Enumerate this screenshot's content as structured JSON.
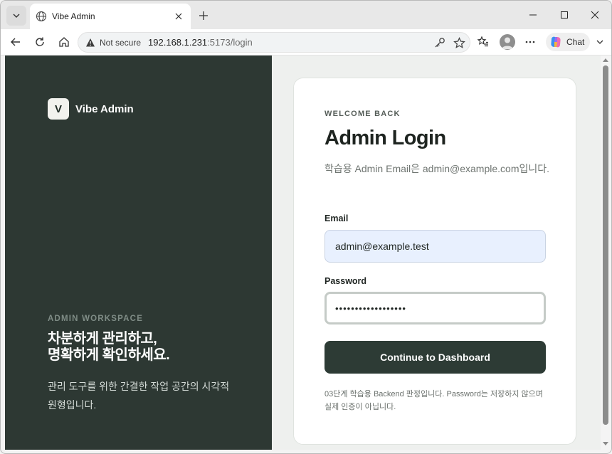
{
  "browser": {
    "tab": {
      "title": "Vibe Admin",
      "icon": "globe-icon"
    },
    "address": {
      "security_label": "Not secure",
      "url_host": "192.168.1.231",
      "url_rest": ":5173/login"
    },
    "chat_label": "Chat"
  },
  "left_panel": {
    "brand_mark": "V",
    "brand_name": "Vibe Admin",
    "eyebrow": "ADMIN WORKSPACE",
    "headline_line1": "차분하게 관리하고,",
    "headline_line2": "명확하게 확인하세요.",
    "description": "관리 도구를 위한 간결한 작업 공간의 시각적 원형입니다."
  },
  "login": {
    "eyebrow": "WELCOME BACK",
    "title": "Admin Login",
    "subtitle": "학습용 Admin Email은 admin@example.com입니다.",
    "email_label": "Email",
    "email_value": "admin@example.test",
    "password_label": "Password",
    "password_value": "••••••••••••••••••",
    "submit_label": "Continue to Dashboard",
    "note": "03단계 학습용 Backend 판정입니다. Password는 저장하지 않으며 실제 인증이 아닙니다."
  },
  "colors": {
    "left_panel_bg": "#2d3833",
    "primary_button": "#2d3b35",
    "email_autofill_bg": "#e8f0fe"
  }
}
